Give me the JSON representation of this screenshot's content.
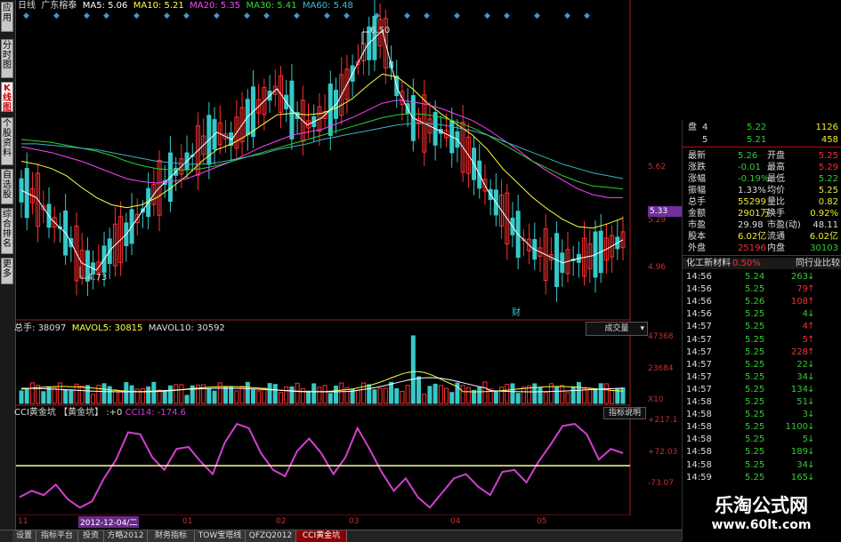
{
  "left_tabs": [
    "应用",
    "分时图",
    "K线图",
    "个股资料",
    "自选股",
    "综合排名",
    "更多"
  ],
  "header": {
    "period": "日线",
    "stock_name": "广东榕泰",
    "ma5_label": "MA5:",
    "ma5": "5.06",
    "ma10_label": "MA10:",
    "ma10": "5.21",
    "ma20_label": "MA20:",
    "ma20": "5.35",
    "ma30_label": "MA30:",
    "ma30": "5.41",
    "ma60_label": "MA60:",
    "ma60": "5.48"
  },
  "price_annotations": {
    "high": "6.50",
    "low": "4.73",
    "current": "5.33",
    "cai_marker": "财"
  },
  "price_axis_ticks": [
    "5.62",
    "5.29",
    "4.96"
  ],
  "volume": {
    "total_label": "总手:",
    "total": "38097",
    "mavol5_label": "MAVOL5:",
    "mavol5": "30815",
    "mavol10_label": "MAVOL10:",
    "mavol10": "30592",
    "dropdown": "成交量",
    "axis_ticks": [
      "47368",
      "23684",
      "X10"
    ]
  },
  "cci": {
    "title": "CCI黄金坑",
    "indicator": "【黄金坑】",
    "param": ":+0",
    "value_label": "CCI14:",
    "value": "-174.6",
    "explain_button": "指标说明",
    "axis_ticks": [
      "+217.1",
      "+72.03",
      "-73.07"
    ]
  },
  "time_axis": {
    "date_box": "2012-12-04/二",
    "labels": [
      "11",
      "01",
      "02",
      "03",
      "04",
      "05"
    ]
  },
  "chart_data": {
    "type": "line",
    "title": "",
    "series": [
      {
        "values": [
          5.4,
          5.35,
          5.2,
          5.1,
          4.9,
          4.85,
          5.0,
          5.1,
          5.25,
          5.4,
          5.5,
          5.6,
          5.7,
          5.8,
          5.75,
          5.9,
          6.0,
          6.1,
          5.95,
          5.85,
          5.9,
          6.0,
          6.2,
          6.4,
          6.5,
          6.1,
          5.9,
          5.85,
          5.8,
          5.75,
          5.6,
          5.4,
          5.25,
          5.1,
          5.0,
          4.95,
          4.9,
          4.93,
          4.95,
          5.0,
          5.06
        ]
      },
      {
        "values": [
          5.6,
          5.58,
          5.55,
          5.5,
          5.42,
          5.35,
          5.3,
          5.28,
          5.3,
          5.35,
          5.42,
          5.5,
          5.6,
          5.68,
          5.72,
          5.78,
          5.85,
          5.92,
          5.93,
          5.92,
          5.93,
          5.97,
          6.03,
          6.12,
          6.2,
          6.18,
          6.1,
          6.0,
          5.92,
          5.85,
          5.78,
          5.68,
          5.55,
          5.45,
          5.35,
          5.27,
          5.2,
          5.15,
          5.14,
          5.17,
          5.21
        ]
      },
      {
        "values": [
          5.7,
          5.68,
          5.66,
          5.63,
          5.6,
          5.56,
          5.52,
          5.48,
          5.46,
          5.45,
          5.46,
          5.48,
          5.52,
          5.56,
          5.6,
          5.65,
          5.7,
          5.74,
          5.78,
          5.8,
          5.82,
          5.86,
          5.9,
          5.95,
          6.0,
          6.02,
          6.01,
          5.99,
          5.96,
          5.92,
          5.88,
          5.82,
          5.75,
          5.68,
          5.6,
          5.53,
          5.47,
          5.41,
          5.37,
          5.35,
          5.35
        ]
      },
      {
        "values": [
          5.75,
          5.74,
          5.73,
          5.71,
          5.69,
          5.67,
          5.64,
          5.6,
          5.57,
          5.55,
          5.54,
          5.54,
          5.55,
          5.57,
          5.6,
          5.63,
          5.66,
          5.69,
          5.72,
          5.75,
          5.78,
          5.81,
          5.84,
          5.87,
          5.9,
          5.92,
          5.93,
          5.92,
          5.9,
          5.87,
          5.83,
          5.78,
          5.72,
          5.66,
          5.6,
          5.55,
          5.5,
          5.46,
          5.43,
          5.42,
          5.41
        ]
      },
      {
        "values": [
          5.72,
          5.72,
          5.71,
          5.7,
          5.69,
          5.68,
          5.66,
          5.64,
          5.62,
          5.6,
          5.59,
          5.58,
          5.58,
          5.59,
          5.61,
          5.63,
          5.65,
          5.68,
          5.7,
          5.72,
          5.75,
          5.77,
          5.79,
          5.81,
          5.83,
          5.85,
          5.86,
          5.86,
          5.85,
          5.83,
          5.81,
          5.78,
          5.74,
          5.7,
          5.66,
          5.62,
          5.58,
          5.55,
          5.52,
          5.5,
          5.48
        ]
      }
    ],
    "ylim": [
      4.6,
      6.6
    ],
    "cci_values": [
      -150,
      -120,
      -140,
      -90,
      -160,
      -200,
      -170,
      -60,
      30,
      160,
      150,
      40,
      -20,
      80,
      90,
      20,
      -40,
      110,
      200,
      180,
      60,
      -20,
      -50,
      70,
      130,
      60,
      -40,
      40,
      180,
      80,
      -30,
      -120,
      -60,
      -150,
      -200,
      -130,
      -60,
      -40,
      -100,
      -140,
      -30,
      -20,
      -80,
      20,
      100,
      190,
      200,
      150,
      30,
      80,
      60
    ],
    "cci_ylim": [
      -220,
      230
    ],
    "cci_threshold": 0
  },
  "right_panel": {
    "pan_label": "盘",
    "level_rows": [
      {
        "idx": "4",
        "price": "5.22",
        "vol": "1126"
      },
      {
        "idx": "5",
        "price": "5.21",
        "vol": "458"
      }
    ],
    "quote_rows": [
      {
        "l1": "最新",
        "v1": "5.26",
        "l2": "开盘",
        "v2": "5.25",
        "c1": "#3c3",
        "c2": "#e33"
      },
      {
        "l1": "涨跌",
        "v1": "-0.01",
        "l2": "最高",
        "v2": "5.29",
        "c1": "#3c3",
        "c2": "#e33"
      },
      {
        "l1": "涨幅",
        "v1": "-0.19%",
        "l2": "最低",
        "v2": "5.22",
        "c1": "#3c3",
        "c2": "#3c3"
      },
      {
        "l1": "振幅",
        "v1": "1.33%",
        "l2": "均价",
        "v2": "5.25",
        "c1": "#ddd",
        "c2": "#ee3"
      },
      {
        "l1": "总手",
        "v1": "55299",
        "l2": "量比",
        "v2": "0.82",
        "c1": "#ee3",
        "c2": "#ee3"
      },
      {
        "l1": "金额",
        "v1": "2901万",
        "l2": "换手",
        "v2": "0.92%",
        "c1": "#ee3",
        "c2": "#ee3"
      },
      {
        "l1": "市盈",
        "v1": "29.98",
        "l2": "市盈(动)",
        "v2": "48.11",
        "c1": "#ddd",
        "c2": "#ddd"
      },
      {
        "l1": "股本",
        "v1": "6.02亿",
        "l2": "流通",
        "v2": "6.02亿",
        "c1": "#ee3",
        "c2": "#ee3"
      },
      {
        "l1": "外盘",
        "v1": "25196",
        "l2": "内盘",
        "v2": "30103",
        "c1": "#e33",
        "c2": "#3c3"
      }
    ],
    "sector": {
      "name": "化工新材料",
      "pct": "0.50%",
      "compare": "同行业比较"
    },
    "ticks": [
      {
        "t": "14:56",
        "p": "5.24",
        "v": "263",
        "up": false
      },
      {
        "t": "14:56",
        "p": "5.25",
        "v": "79",
        "up": true
      },
      {
        "t": "14:56",
        "p": "5.26",
        "v": "108",
        "up": true
      },
      {
        "t": "14:56",
        "p": "5.25",
        "v": "4",
        "up": false
      },
      {
        "t": "14:57",
        "p": "5.25",
        "v": "4",
        "up": true
      },
      {
        "t": "14:57",
        "p": "5.25",
        "v": "5",
        "up": true
      },
      {
        "t": "14:57",
        "p": "5.25",
        "v": "228",
        "up": true
      },
      {
        "t": "14:57",
        "p": "5.25",
        "v": "22",
        "up": false
      },
      {
        "t": "14:57",
        "p": "5.25",
        "v": "34",
        "up": false
      },
      {
        "t": "14:57",
        "p": "5.25",
        "v": "134",
        "up": false
      },
      {
        "t": "14:58",
        "p": "5.25",
        "v": "51",
        "up": false
      },
      {
        "t": "14:58",
        "p": "5.25",
        "v": "3",
        "up": false
      },
      {
        "t": "14:58",
        "p": "5.25",
        "v": "1100",
        "up": false
      },
      {
        "t": "14:58",
        "p": "5.25",
        "v": "5",
        "up": false
      },
      {
        "t": "14:58",
        "p": "5.25",
        "v": "189",
        "up": false
      },
      {
        "t": "14:58",
        "p": "5.25",
        "v": "34",
        "up": false
      },
      {
        "t": "14:59",
        "p": "5.25",
        "v": "165",
        "up": false
      }
    ]
  },
  "bottom_tabs": [
    "设置",
    "指标平台",
    "投资",
    "方略2012",
    "财务指标",
    "TOW宝塔线",
    "QFZQ2012",
    "CCI黄金坑"
  ],
  "watermark": {
    "title": "乐淘公式网",
    "url": "www.60lt.com"
  },
  "colors": {
    "up": "#ff3030",
    "down": "#36c8c8",
    "ma5": "#ffffff",
    "ma10": "#ffff40",
    "ma20": "#ff40ff",
    "ma30": "#30d030",
    "ma60": "#40b0c0",
    "cci": "#d040d0"
  }
}
